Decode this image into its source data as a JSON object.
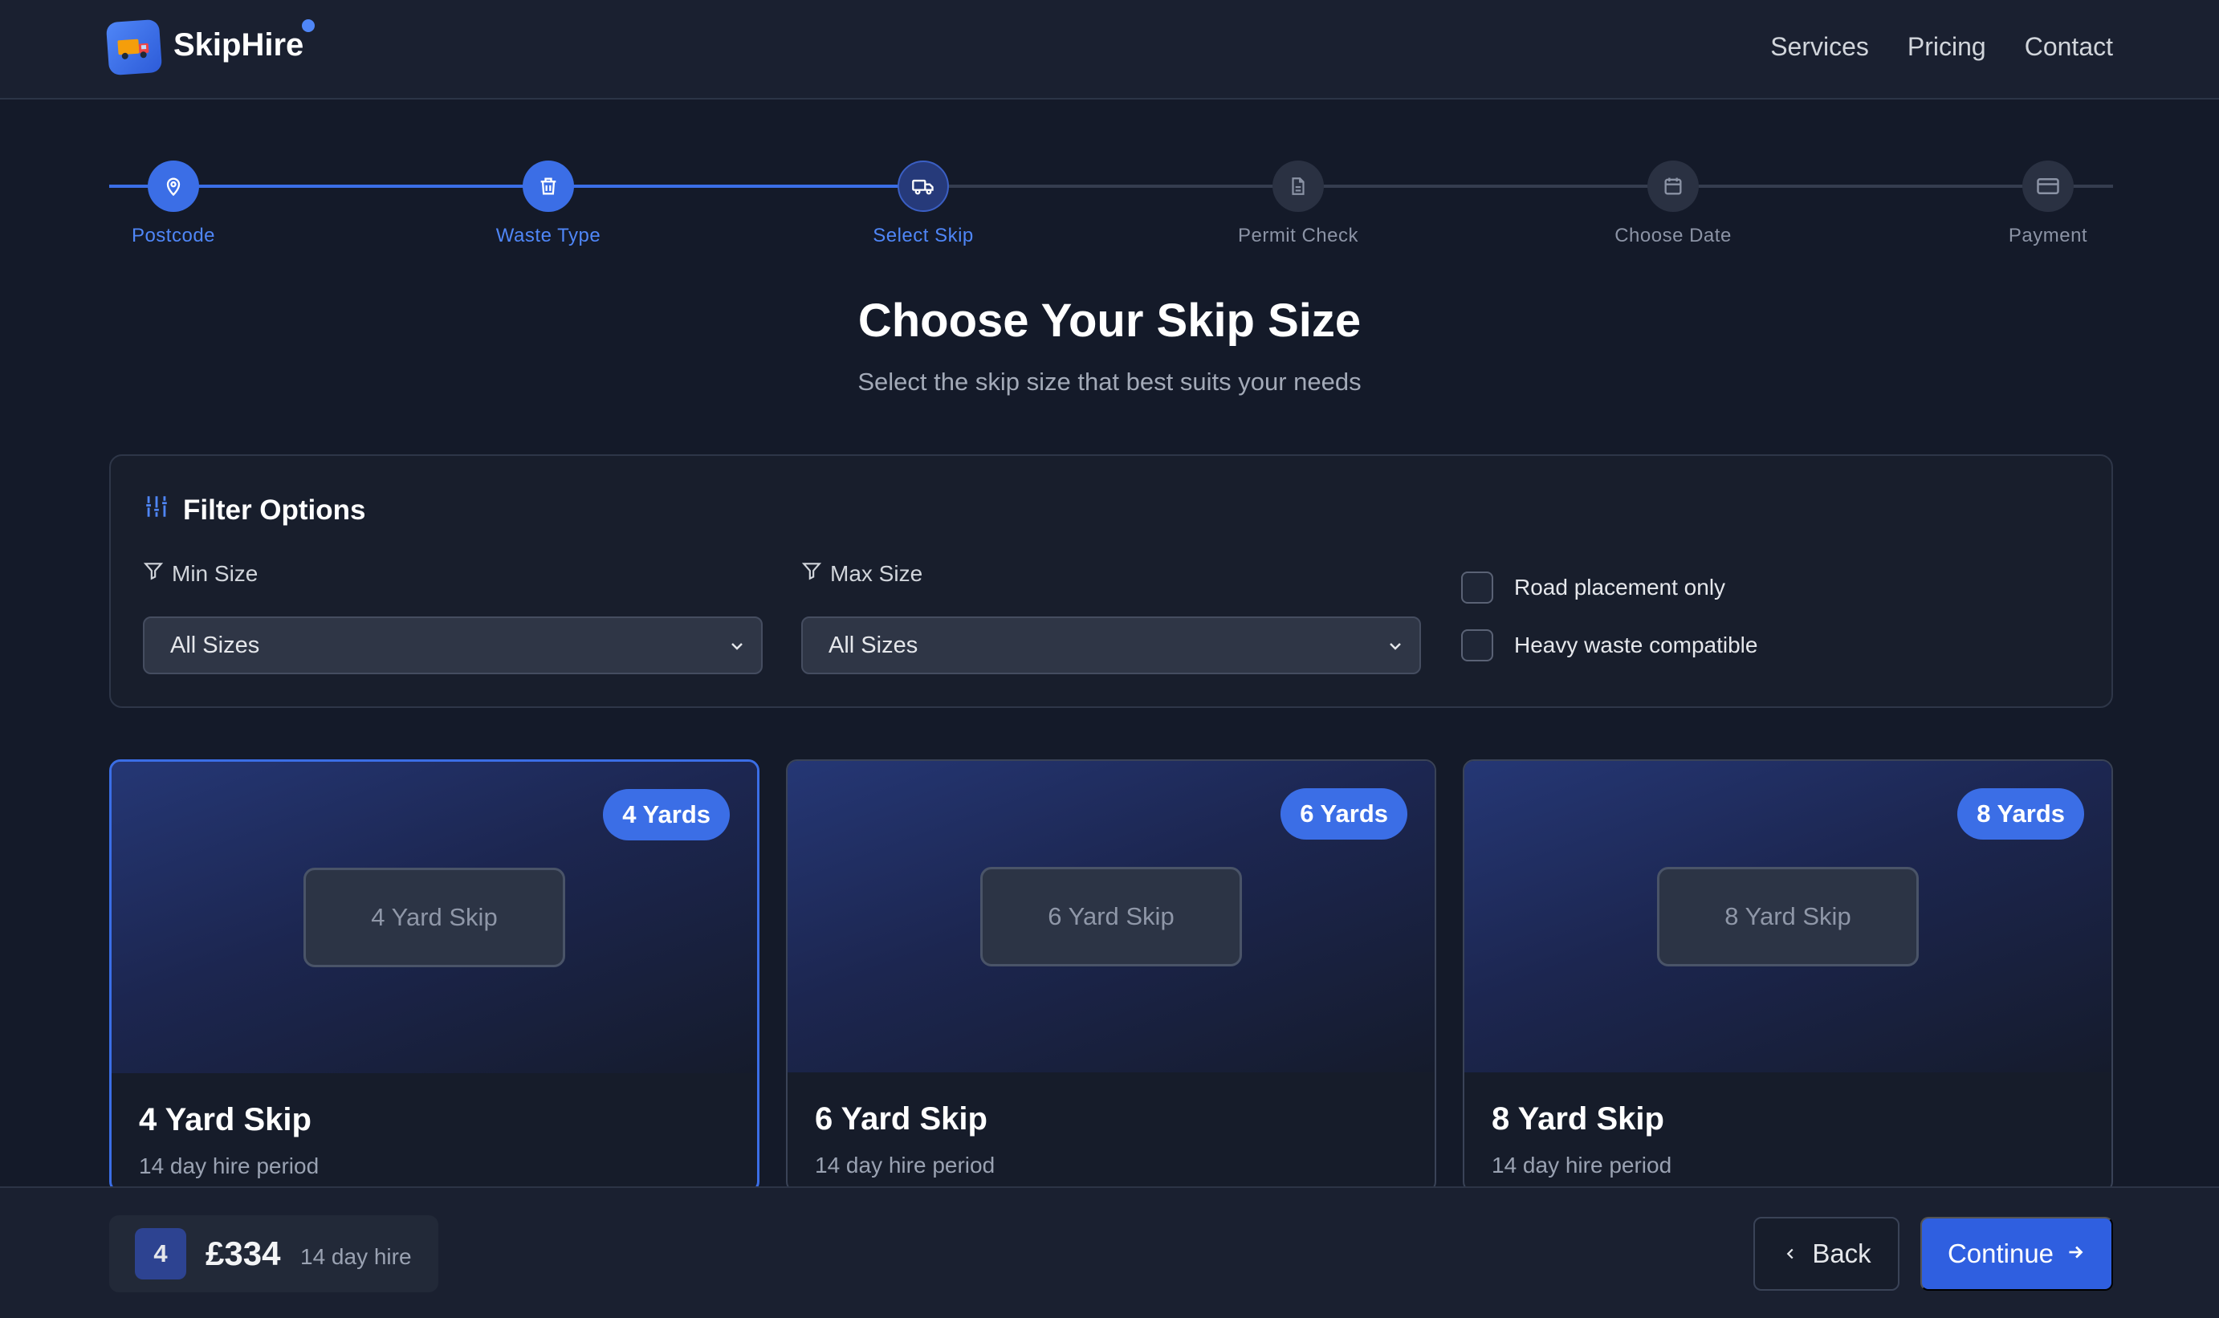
{
  "header": {
    "brand": "SkipHire",
    "nav": [
      "Services",
      "Pricing",
      "Contact"
    ]
  },
  "stepper": {
    "steps": [
      {
        "label": "Postcode",
        "state": "done",
        "icon": "map-pin-icon"
      },
      {
        "label": "Waste Type",
        "state": "done",
        "icon": "trash-icon"
      },
      {
        "label": "Select Skip",
        "state": "current",
        "icon": "truck-icon"
      },
      {
        "label": "Permit Check",
        "state": "todo",
        "icon": "document-icon"
      },
      {
        "label": "Choose Date",
        "state": "todo",
        "icon": "calendar-icon"
      },
      {
        "label": "Payment",
        "state": "todo",
        "icon": "credit-card-icon"
      }
    ]
  },
  "main": {
    "title": "Choose Your Skip Size",
    "subtitle": "Select the skip size that best suits your needs"
  },
  "filters": {
    "title": "Filter Options",
    "min_label": "Min Size",
    "max_label": "Max Size",
    "min_value": "All Sizes",
    "max_value": "All Sizes",
    "road_label": "Road placement only",
    "heavy_label": "Heavy waste compatible"
  },
  "cards": [
    {
      "badge": "4 Yards",
      "placeholder": "4 Yard Skip",
      "name": "4 Yard Skip",
      "period": "14 day hire period",
      "selected": true
    },
    {
      "badge": "6 Yards",
      "placeholder": "6 Yard Skip",
      "name": "6 Yard Skip",
      "period": "14 day hire period",
      "selected": false
    },
    {
      "badge": "8 Yards",
      "placeholder": "8 Yard Skip",
      "name": "8 Yard Skip",
      "period": "14 day hire period",
      "selected": false
    }
  ],
  "footer": {
    "size": "4",
    "price": "£334",
    "hire": "14 day hire",
    "back": "Back",
    "continue": "Continue"
  },
  "colors": {
    "accent": "#3b6ee6",
    "background": "#141a29"
  }
}
